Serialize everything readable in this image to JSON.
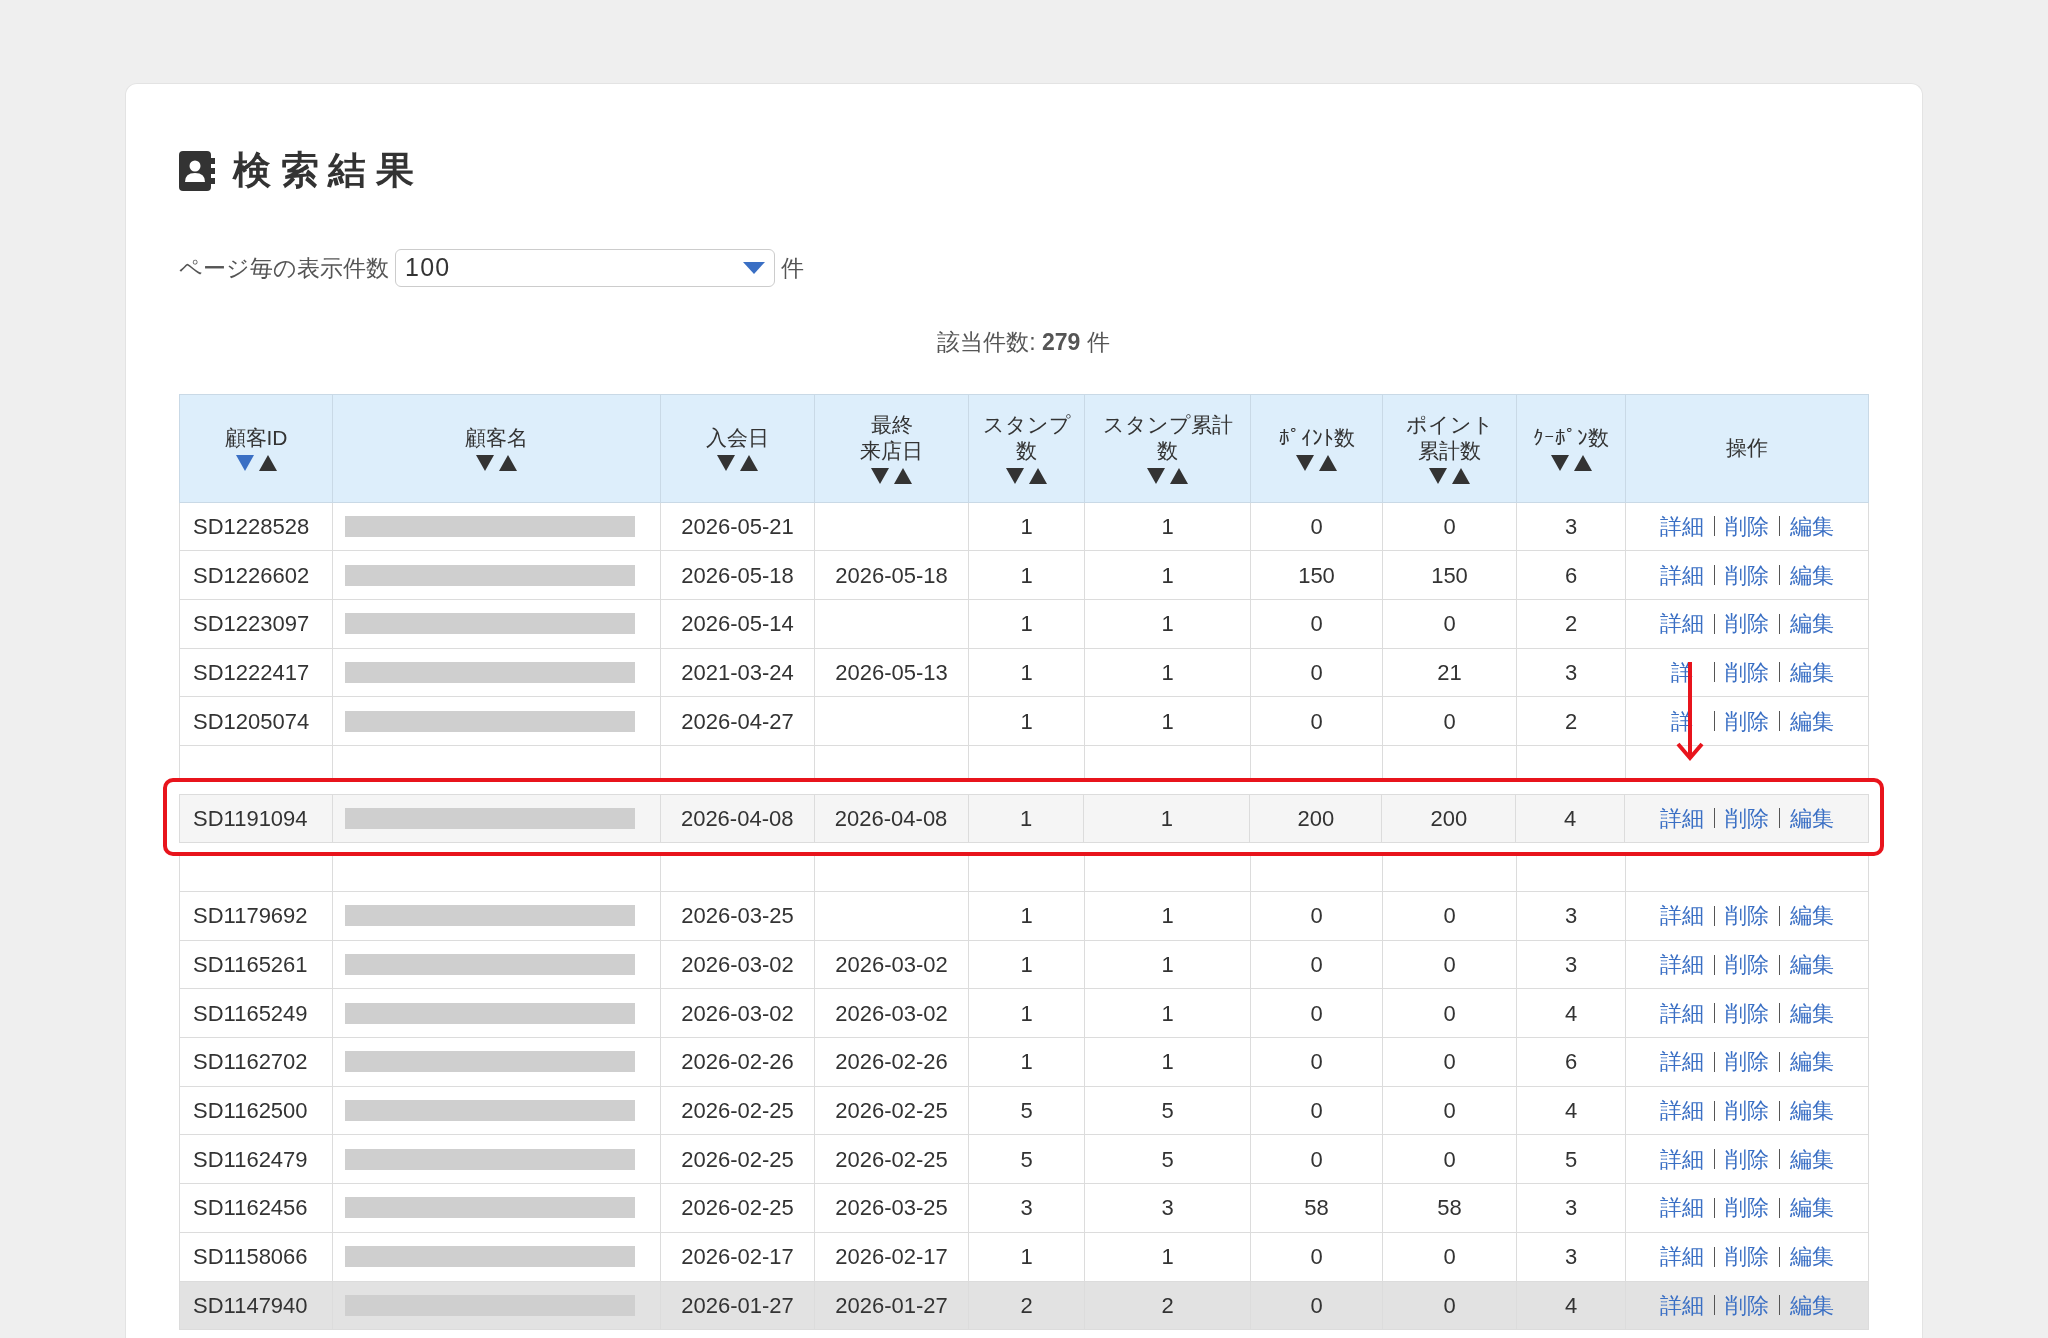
{
  "title": "検索結果",
  "page_size": {
    "label": "ページ毎の表示件数",
    "value": "100",
    "unit": "件"
  },
  "result_count": "該当件数: **279** 件",
  "table": {
    "columns": [
      {
        "lines": [
          "顧客ID"
        ],
        "sortable": true,
        "sorted_desc": true
      },
      {
        "lines": [
          "顧客名"
        ],
        "sortable": true,
        "sorted_desc": false
      },
      {
        "lines": [
          "入会日"
        ],
        "sortable": true,
        "sorted_desc": false
      },
      {
        "lines": [
          "最終",
          "来店日"
        ],
        "sortable": true,
        "sorted_desc": false
      },
      {
        "lines": [
          "スタンプ",
          "数"
        ],
        "sortable": true,
        "sorted_desc": false
      },
      {
        "lines": [
          "スタンプ累計",
          "数"
        ],
        "sortable": true,
        "sorted_desc": false
      },
      {
        "lines": [
          "ﾎﾟｲﾝﾄ数"
        ],
        "sortable": true,
        "sorted_desc": false
      },
      {
        "lines": [
          "ポイント",
          "累計数"
        ],
        "sortable": true,
        "sorted_desc": false
      },
      {
        "lines": [
          "ｸｰﾎﾟﾝ数"
        ],
        "sortable": true,
        "sorted_desc": false
      },
      {
        "lines": [
          "操作"
        ],
        "sortable": false
      }
    ],
    "rows": [
      {
        "id": "SD1228528",
        "joined": "2026-05-21",
        "last_visit": "",
        "stamps": "1",
        "stamp_total": "1",
        "points": "0",
        "point_total": "0",
        "coupons": "3",
        "actions": [
          "詳細",
          "削除",
          "編集"
        ],
        "dragged": false,
        "highlighted": false
      },
      {
        "id": "SD1226602",
        "joined": "2026-05-18",
        "last_visit": "2026-05-18",
        "stamps": "1",
        "stamp_total": "1",
        "points": "150",
        "point_total": "150",
        "coupons": "6",
        "actions": [
          "詳細",
          "削除",
          "編集"
        ],
        "dragged": false,
        "highlighted": false
      },
      {
        "id": "SD1223097",
        "joined": "2026-05-14",
        "last_visit": "",
        "stamps": "1",
        "stamp_total": "1",
        "points": "0",
        "point_total": "0",
        "coupons": "2",
        "actions": [
          "詳細",
          "削除",
          "編集"
        ],
        "dragged": false,
        "highlighted": false
      },
      {
        "id": "SD1222417",
        "joined": "2021-03-24",
        "last_visit": "2026-05-13",
        "stamps": "1",
        "stamp_total": "1",
        "points": "0",
        "point_total": "21",
        "coupons": "3",
        "actions": [
          "詳",
          "削除",
          "編集"
        ],
        "dragged": false,
        "highlighted": false
      },
      {
        "id": "SD1205074",
        "joined": "2026-04-27",
        "last_visit": "",
        "stamps": "1",
        "stamp_total": "1",
        "points": "0",
        "point_total": "0",
        "coupons": "2",
        "actions": [
          "詳",
          "削除",
          "編集"
        ],
        "dragged": false,
        "highlighted": false
      },
      {
        "id": "SD1191094",
        "joined": "2026-04-08",
        "last_visit": "2026-04-08",
        "stamps": "1",
        "stamp_total": "1",
        "points": "200",
        "point_total": "200",
        "coupons": "4",
        "actions": [
          "詳細",
          "削除",
          "編集"
        ],
        "dragged": true,
        "highlighted": false
      },
      {
        "id": "SD1179692",
        "joined": "2026-03-25",
        "last_visit": "",
        "stamps": "1",
        "stamp_total": "1",
        "points": "0",
        "point_total": "0",
        "coupons": "3",
        "actions": [
          "詳細",
          "削除",
          "編集"
        ],
        "dragged": false,
        "highlighted": false
      },
      {
        "id": "SD1165261",
        "joined": "2026-03-02",
        "last_visit": "2026-03-02",
        "stamps": "1",
        "stamp_total": "1",
        "points": "0",
        "point_total": "0",
        "coupons": "3",
        "actions": [
          "詳細",
          "削除",
          "編集"
        ],
        "dragged": false,
        "highlighted": false
      },
      {
        "id": "SD1165249",
        "joined": "2026-03-02",
        "last_visit": "2026-03-02",
        "stamps": "1",
        "stamp_total": "1",
        "points": "0",
        "point_total": "0",
        "coupons": "4",
        "actions": [
          "詳細",
          "削除",
          "編集"
        ],
        "dragged": false,
        "highlighted": false
      },
      {
        "id": "SD1162702",
        "joined": "2026-02-26",
        "last_visit": "2026-02-26",
        "stamps": "1",
        "stamp_total": "1",
        "points": "0",
        "point_total": "0",
        "coupons": "6",
        "actions": [
          "詳細",
          "削除",
          "編集"
        ],
        "dragged": false,
        "highlighted": false
      },
      {
        "id": "SD1162500",
        "joined": "2026-02-25",
        "last_visit": "2026-02-25",
        "stamps": "5",
        "stamp_total": "5",
        "points": "0",
        "point_total": "0",
        "coupons": "4",
        "actions": [
          "詳細",
          "削除",
          "編集"
        ],
        "dragged": false,
        "highlighted": false
      },
      {
        "id": "SD1162479",
        "joined": "2026-02-25",
        "last_visit": "2026-02-25",
        "stamps": "5",
        "stamp_total": "5",
        "points": "0",
        "point_total": "0",
        "coupons": "5",
        "actions": [
          "詳細",
          "削除",
          "編集"
        ],
        "dragged": false,
        "highlighted": false
      },
      {
        "id": "SD1162456",
        "joined": "2026-02-25",
        "last_visit": "2026-03-25",
        "stamps": "3",
        "stamp_total": "3",
        "points": "58",
        "point_total": "58",
        "coupons": "3",
        "actions": [
          "詳細",
          "削除",
          "編集"
        ],
        "dragged": false,
        "highlighted": false
      },
      {
        "id": "SD1158066",
        "joined": "2026-02-17",
        "last_visit": "2026-02-17",
        "stamps": "1",
        "stamp_total": "1",
        "points": "0",
        "point_total": "0",
        "coupons": "3",
        "actions": [
          "詳細",
          "削除",
          "編集"
        ],
        "dragged": false,
        "highlighted": false
      },
      {
        "id": "SD1147940",
        "joined": "2026-01-27",
        "last_visit": "2026-01-27",
        "stamps": "2",
        "stamp_total": "2",
        "points": "0",
        "point_total": "0",
        "coupons": "4",
        "actions": [
          "詳細",
          "削除",
          "編集"
        ],
        "dragged": false,
        "highlighted": true
      }
    ]
  }
}
